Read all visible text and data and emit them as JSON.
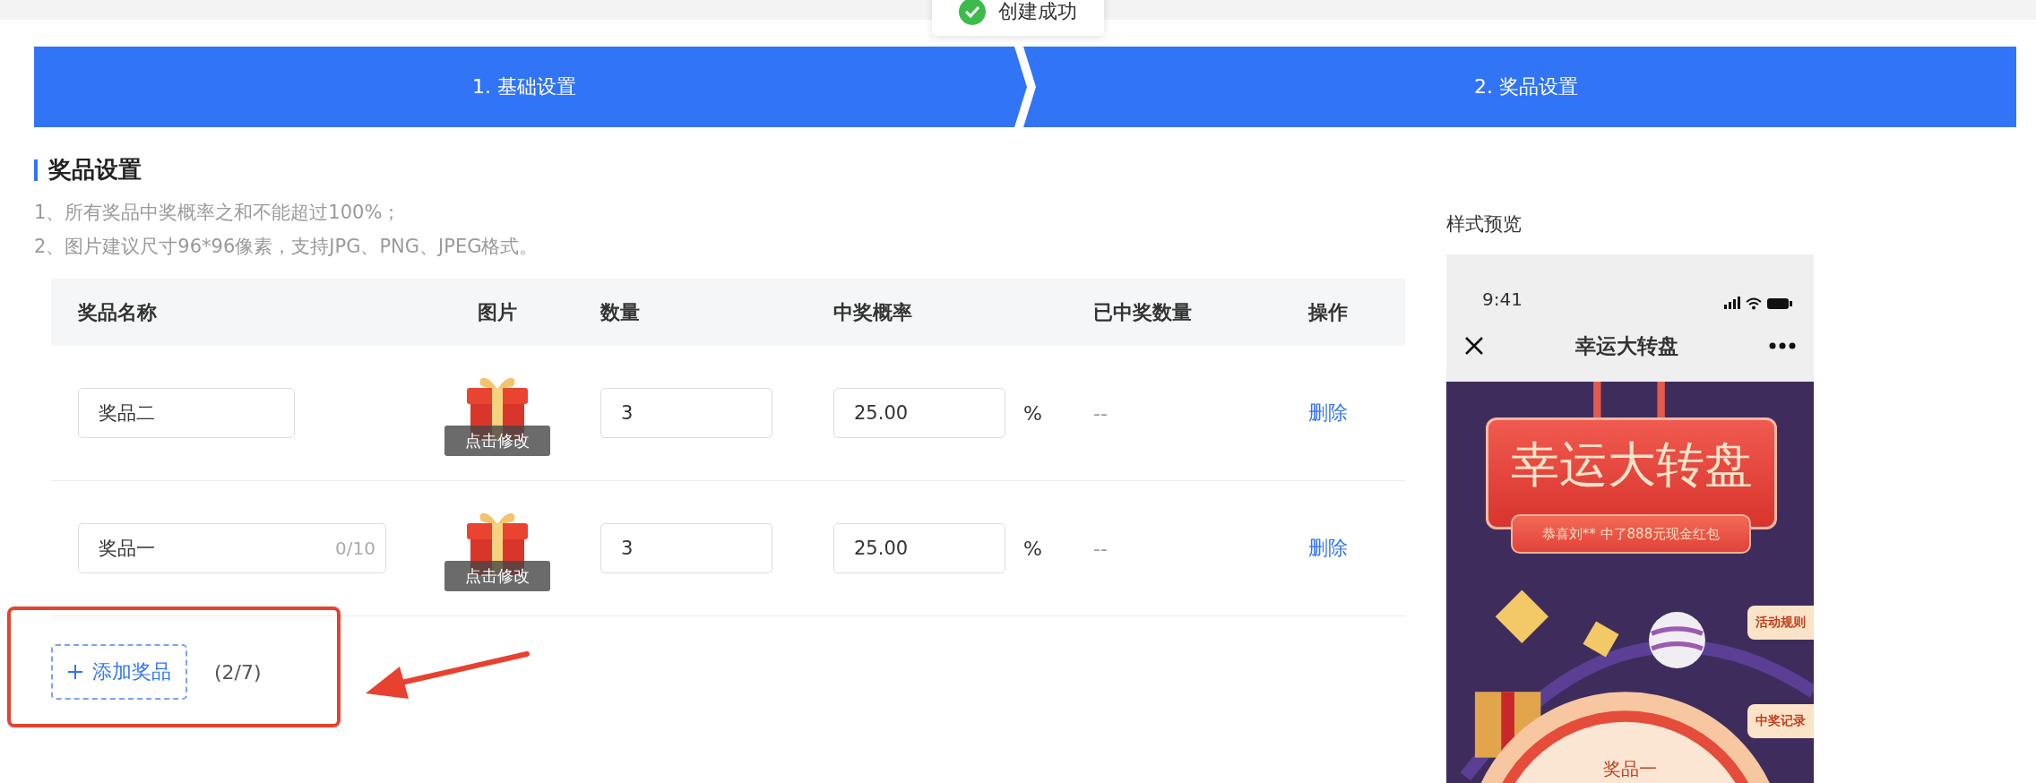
{
  "toast": {
    "text": "创建成功"
  },
  "steps": [
    {
      "label": "1. 基础设置",
      "active": true
    },
    {
      "label": "2. 奖品设置",
      "active": true
    }
  ],
  "section": {
    "title": "奖品设置",
    "notes": [
      "1、所有奖品中奖概率之和不能超过100%；",
      "2、图片建议尺寸96*96像素，支持JPG、PNG、JPEG格式。"
    ]
  },
  "table": {
    "columns": [
      "奖品名称",
      "图片",
      "数量",
      "中奖概率",
      "已中奖数量",
      "操作"
    ],
    "rows": [
      {
        "name": "奖品二",
        "image_caption": "点击修改",
        "quantity": "3",
        "probability": "25.00",
        "unit": "%",
        "won": "--",
        "action": "删除"
      },
      {
        "name": "奖品一",
        "counter": "0/10",
        "image_caption": "点击修改",
        "quantity": "3",
        "probability": "25.00",
        "unit": "%",
        "won": "--",
        "action": "删除"
      }
    ]
  },
  "add_button": {
    "label": "添加奖品",
    "count": "(2/7)"
  },
  "preview": {
    "label": "样式预览",
    "phone": {
      "time": "9:41",
      "title": "幸运大转盘",
      "banner_title": "幸运大转盘",
      "ticker": "恭喜刘** 中了888元现金红包",
      "side_buttons": [
        "活动规则",
        "中奖记录"
      ],
      "wheel_label": "奖品一"
    }
  }
}
